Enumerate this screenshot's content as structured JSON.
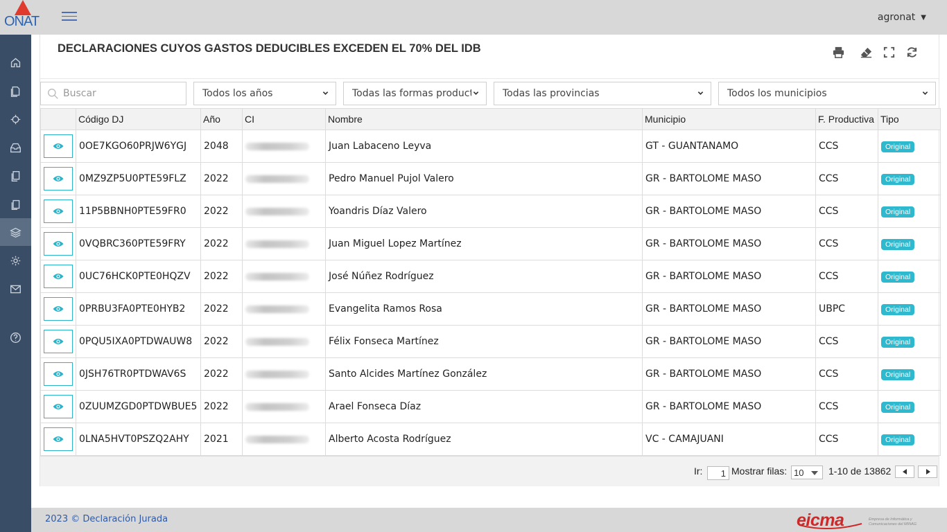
{
  "app": {
    "logo_text": "ONAT",
    "user": "agronat"
  },
  "page": {
    "title": "DECLARACIONES CUYOS GASTOS DEDUCIBLES EXCEDEN EL 70% DEL IDB"
  },
  "filters": {
    "search_placeholder": "Buscar",
    "year": "Todos los años",
    "form": "Todas las formas producti",
    "province": "Todas las provincias",
    "municipality": "Todos los municipios"
  },
  "table": {
    "headers": [
      "",
      "Código DJ",
      "Año",
      "CI",
      "Nombre",
      "Municipio",
      "F. Productiva",
      "Tipo"
    ],
    "rows": [
      {
        "code": "0OE7KGO60PRJW6YGJ",
        "year": "2048",
        "name": "Juan Labaceno Leyva",
        "municipality": "GT - GUANTANAMO",
        "form": "CCS",
        "type": "Original"
      },
      {
        "code": "0MZ9ZP5U0PTE59FLZ",
        "year": "2022",
        "name": "Pedro Manuel Pujol Valero",
        "municipality": "GR - BARTOLOME MASO",
        "form": "CCS",
        "type": "Original"
      },
      {
        "code": "11P5BBNH0PTE59FR0",
        "year": "2022",
        "name": "Yoandris Díaz Valero",
        "municipality": "GR - BARTOLOME MASO",
        "form": "CCS",
        "type": "Original"
      },
      {
        "code": "0VQBRC360PTE59FRY",
        "year": "2022",
        "name": "Juan Miguel Lopez Martínez",
        "municipality": "GR - BARTOLOME MASO",
        "form": "CCS",
        "type": "Original"
      },
      {
        "code": "0UC76HCK0PTE0HQZV",
        "year": "2022",
        "name": "José Núñez Rodríguez",
        "municipality": "GR - BARTOLOME MASO",
        "form": "CCS",
        "type": "Original"
      },
      {
        "code": "0PRBU3FA0PTE0HYB2",
        "year": "2022",
        "name": "Evangelita Ramos Rosa",
        "municipality": "GR - BARTOLOME MASO",
        "form": "UBPC",
        "type": "Original"
      },
      {
        "code": "0PQU5IXA0PTDWAUW8",
        "year": "2022",
        "name": "Félix Fonseca Martínez",
        "municipality": "GR - BARTOLOME MASO",
        "form": "CCS",
        "type": "Original"
      },
      {
        "code": "0JSH76TR0PTDWAV6S",
        "year": "2022",
        "name": "Santo Alcides Martínez González",
        "municipality": "GR - BARTOLOME MASO",
        "form": "CCS",
        "type": "Original"
      },
      {
        "code": "0ZUUMZGD0PTDWBUE5",
        "year": "2022",
        "name": "Arael Fonseca Díaz",
        "municipality": "GR - BARTOLOME MASO",
        "form": "CCS",
        "type": "Original"
      },
      {
        "code": "0LNA5HVT0PSZQ2AHY",
        "year": "2021",
        "name": "Alberto Acosta Rodríguez",
        "municipality": "VC - CAMAJUANI",
        "form": "CCS",
        "type": "Original"
      }
    ]
  },
  "pager": {
    "goto_label": "Ir:",
    "goto_value": "1",
    "rows_label": "Mostrar filas:",
    "rows_value": "10",
    "range": "1-10 de 13862"
  },
  "footer": {
    "copyright": "2023 © Declaración Jurada",
    "brand": "eicma",
    "brand_sub": "Empresa de Informática y Comunicaciones del MINAG"
  },
  "colors": {
    "accent": "#2fb9cf",
    "sidebar": "#3a4d66",
    "topbar": "#d8d8d8",
    "link": "#2f5aa6"
  },
  "sidebar_icons": [
    "home-icon",
    "documents-icon",
    "target-icon",
    "inbox-icon",
    "copy-icon",
    "paste-icon",
    "layers-icon",
    "gear-icon",
    "mail-icon",
    "help-icon"
  ]
}
